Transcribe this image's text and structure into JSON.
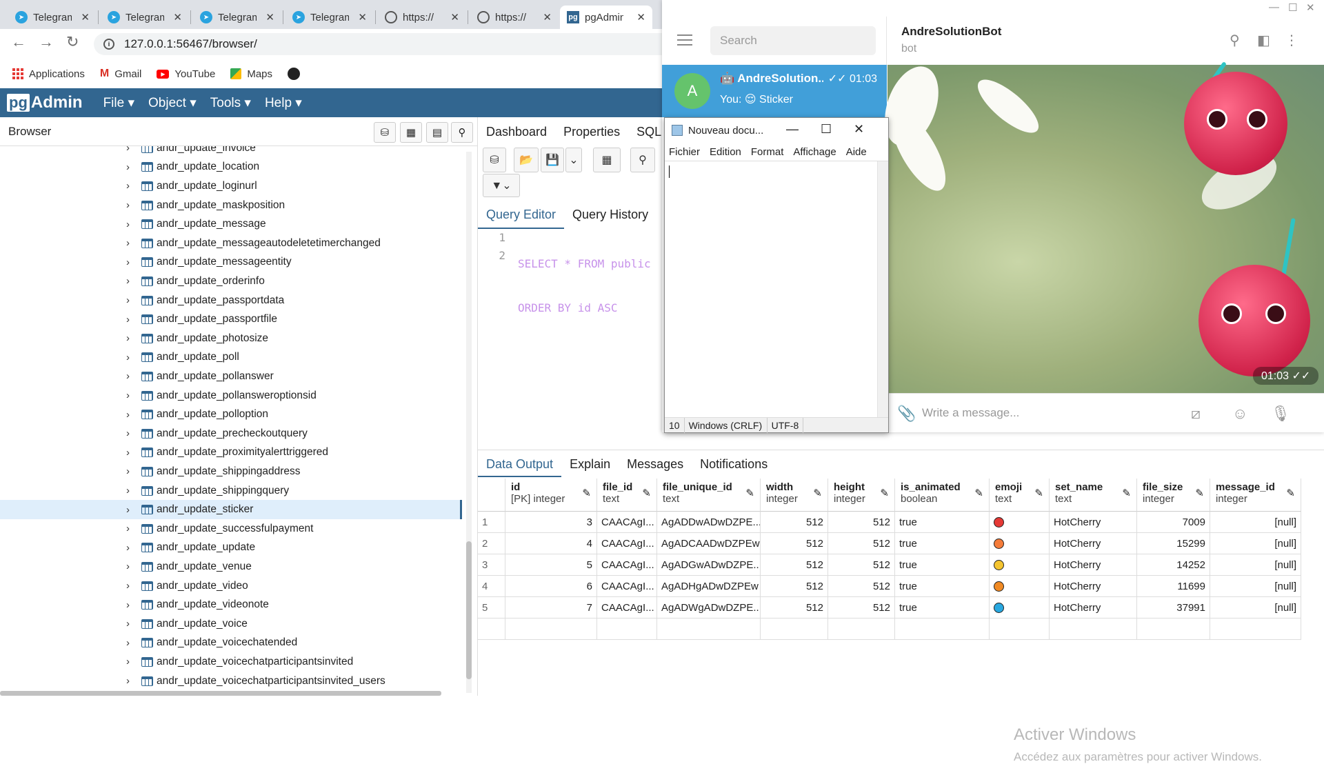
{
  "chrome": {
    "tabs": [
      {
        "title": "Telegram",
        "icon": "telegram-icon"
      },
      {
        "title": "Telegram",
        "icon": "telegram-icon"
      },
      {
        "title": "Telegram",
        "icon": "telegram-icon"
      },
      {
        "title": "Telegram",
        "icon": "telegram-icon"
      },
      {
        "title": "https://",
        "icon": "globe-icon"
      },
      {
        "title": "https://",
        "icon": "globe-icon"
      },
      {
        "title": "pgAdmin",
        "icon": "pgadmin-icon",
        "active": true
      }
    ],
    "url": "127.0.0.1:56467/browser/",
    "bookmarks": [
      "Applications",
      "Gmail",
      "YouTube",
      "Maps"
    ]
  },
  "pgadmin": {
    "logo_pg": "pg",
    "logo_admin": "Admin",
    "menus": [
      "File",
      "Object",
      "Tools",
      "Help"
    ],
    "browser_title": "Browser",
    "tree": [
      "andr_update_invoice",
      "andr_update_location",
      "andr_update_loginurl",
      "andr_update_maskposition",
      "andr_update_message",
      "andr_update_messageautodeletetimerchanged",
      "andr_update_messageentity",
      "andr_update_orderinfo",
      "andr_update_passportdata",
      "andr_update_passportfile",
      "andr_update_photosize",
      "andr_update_poll",
      "andr_update_pollanswer",
      "andr_update_pollansweroptionsid",
      "andr_update_polloption",
      "andr_update_precheckoutquery",
      "andr_update_proximityalerttriggered",
      "andr_update_shippingaddress",
      "andr_update_shippingquery",
      "andr_update_sticker",
      "andr_update_successfulpayment",
      "andr_update_update",
      "andr_update_venue",
      "andr_update_video",
      "andr_update_videonote",
      "andr_update_voice",
      "andr_update_voicechatended",
      "andr_update_voicechatparticipantsinvited",
      "andr_update_voicechatparticipantsinvited_users"
    ],
    "selected_tree_item": "andr_update_sticker",
    "top_tabs": [
      "Dashboard",
      "Properties",
      "SQL"
    ],
    "editor_tabs": [
      "Query Editor",
      "Query History"
    ],
    "code_lines": [
      "SELECT * FROM public",
      "ORDER BY id ASC"
    ],
    "result_tabs": [
      "Data Output",
      "Explain",
      "Messages",
      "Notifications"
    ],
    "columns": [
      {
        "name": "id",
        "type": "[PK] integer"
      },
      {
        "name": "file_id",
        "type": "text"
      },
      {
        "name": "file_unique_id",
        "type": "text"
      },
      {
        "name": "width",
        "type": "integer"
      },
      {
        "name": "height",
        "type": "integer"
      },
      {
        "name": "is_animated",
        "type": "boolean"
      },
      {
        "name": "emoji",
        "type": "text"
      },
      {
        "name": "set_name",
        "type": "text"
      },
      {
        "name": "file_size",
        "type": "integer"
      },
      {
        "name": "message_id",
        "type": "integer"
      }
    ],
    "rows": [
      {
        "n": "1",
        "id": "3",
        "file_id": "CAACAgI...",
        "file_unique_id": "AgADDwADwDZPE...",
        "width": "512",
        "height": "512",
        "is_animated": "true",
        "emoji_color": "#e53935",
        "set_name": "HotCherry",
        "file_size": "7009",
        "message_id": "[null]"
      },
      {
        "n": "2",
        "id": "4",
        "file_id": "CAACAgI...",
        "file_unique_id": "AgADCAADwDZPEw",
        "width": "512",
        "height": "512",
        "is_animated": "true",
        "emoji_color": "#f57c3a",
        "set_name": "HotCherry",
        "file_size": "15299",
        "message_id": "[null]"
      },
      {
        "n": "3",
        "id": "5",
        "file_id": "CAACAgI...",
        "file_unique_id": "AgADGwADwDZPE...",
        "width": "512",
        "height": "512",
        "is_animated": "true",
        "emoji_color": "#f4c430",
        "set_name": "HotCherry",
        "file_size": "14252",
        "message_id": "[null]"
      },
      {
        "n": "4",
        "id": "6",
        "file_id": "CAACAgI...",
        "file_unique_id": "AgADHgADwDZPEw",
        "width": "512",
        "height": "512",
        "is_animated": "true",
        "emoji_color": "#f08a24",
        "set_name": "HotCherry",
        "file_size": "11699",
        "message_id": "[null]"
      },
      {
        "n": "5",
        "id": "7",
        "file_id": "CAACAgI...",
        "file_unique_id": "AgADWgADwDZPE...",
        "width": "512",
        "height": "512",
        "is_animated": "true",
        "emoji_color": "#29a8e0",
        "set_name": "HotCherry",
        "file_size": "37991",
        "message_id": "[null]"
      }
    ],
    "watermark_title": "Activer Windows",
    "watermark_sub": "Accédez aux paramètres pour activer Windows."
  },
  "telegram": {
    "search_placeholder": "Search",
    "chat_name": "AndreSolution...",
    "chat_time": "01:03",
    "chat_preview": "You: 😌 Sticker",
    "avatar_letter": "A",
    "header_name": "AndreSolutionBot",
    "header_status": "bot",
    "sticker_time": "01:03",
    "input_placeholder": "Write a message..."
  },
  "notepad": {
    "title": "Nouveau docu...",
    "menu": [
      "Fichier",
      "Edition",
      "Format",
      "Affichage",
      "Aide"
    ],
    "status": [
      "10",
      "Windows (CRLF)",
      "UTF-8"
    ]
  }
}
